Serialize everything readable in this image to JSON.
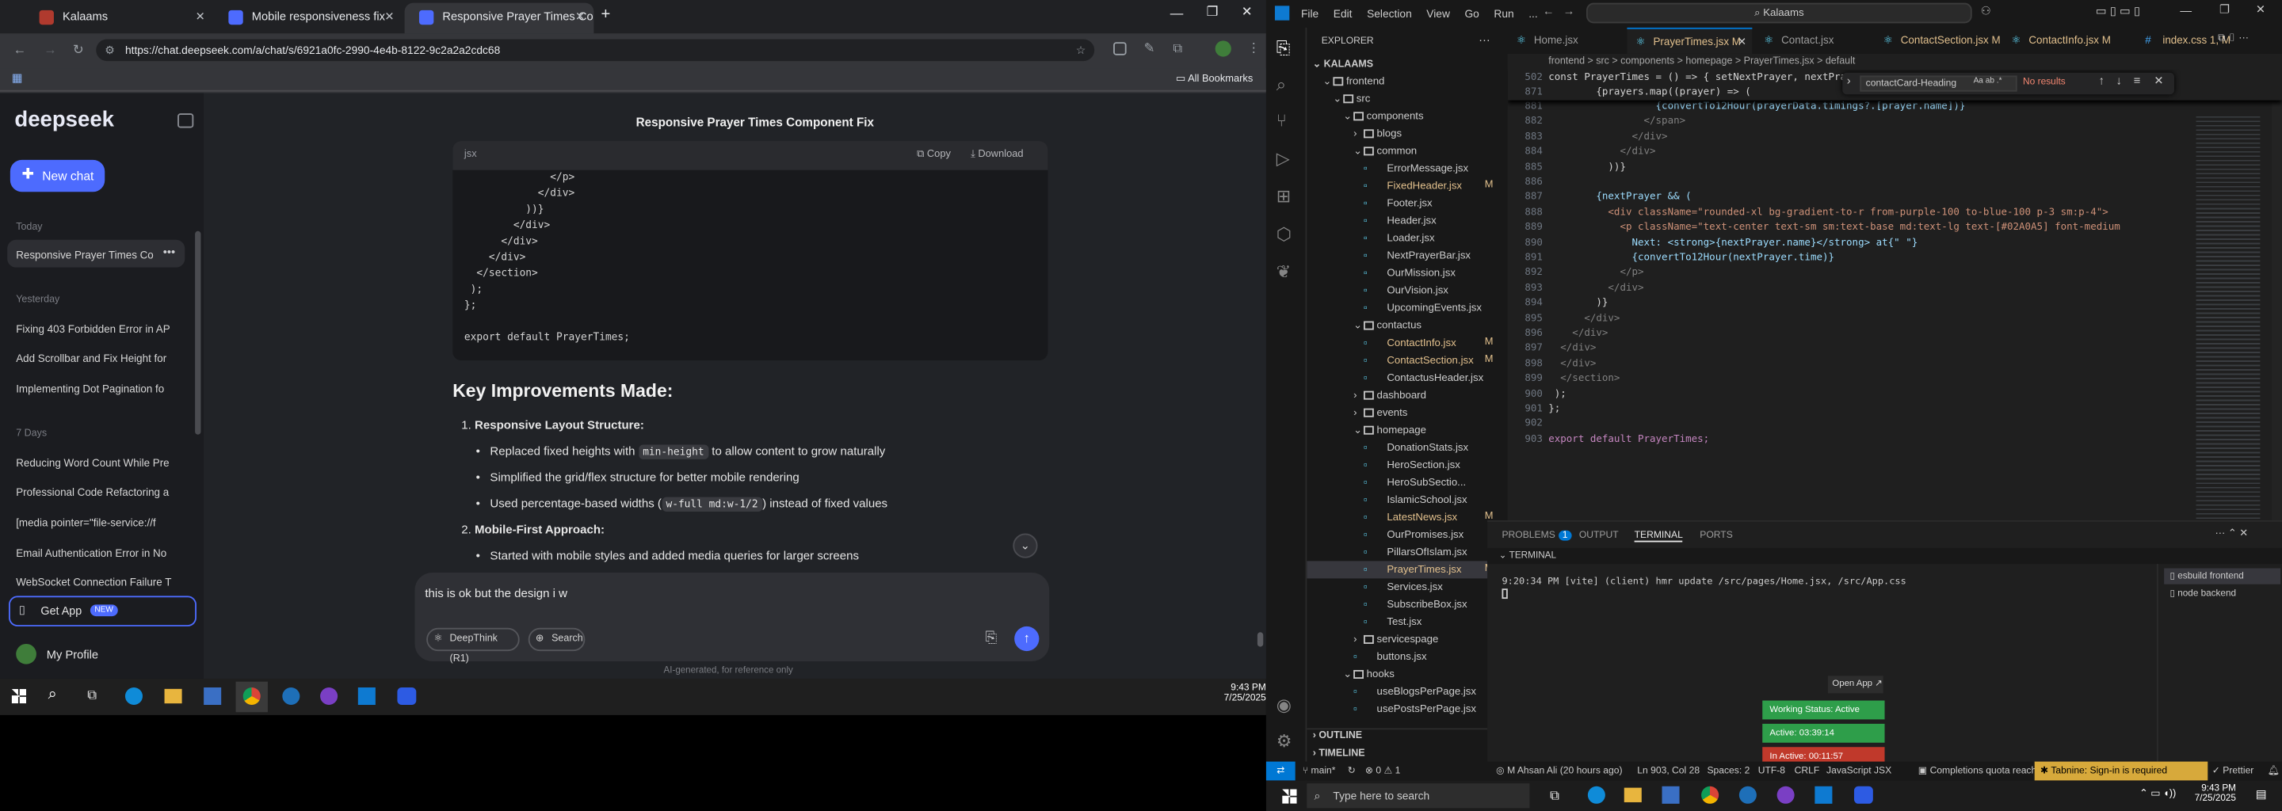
{
  "chrome": {
    "tabs": [
      {
        "label": "Kalaams",
        "active": false
      },
      {
        "label": "Mobile responsiveness fix",
        "active": false
      },
      {
        "label": "Responsive Prayer Times Comp",
        "active": true
      }
    ],
    "url": "https://chat.deepseek.com/a/chat/s/6921a0fc-2990-4e4b-8122-9c2a2a2cdc68",
    "bookmarks_label": "All Bookmarks"
  },
  "deepseek": {
    "logo": "deepseek",
    "new_chat": "New chat",
    "today_label": "Today",
    "today_items": [
      "Responsive Prayer Times Co"
    ],
    "yesterday_label": "Yesterday",
    "yesterday_items": [
      "Fixing 403 Forbidden Error in AP",
      "Add Scrollbar and Fix Height for",
      "Implementing Dot Pagination fo"
    ],
    "week_label": "7 Days",
    "week_items": [
      "Reducing Word Count While Pre",
      "Professional Code Refactoring a",
      "[media pointer=\"file-service://f",
      "Email Authentication Error in No",
      "WebSocket Connection Failure T"
    ],
    "get_app": "Get App",
    "new_badge": "NEW",
    "profile": "My Profile",
    "chat_title": "Responsive Prayer Times Component Fix",
    "code_lang": "jsx",
    "copy": "Copy",
    "download": "Download",
    "code_lines": [
      "              </p>",
      "            </div>",
      "          ))}",
      "        </div>",
      "      </div>",
      "    </div>",
      "  </section>",
      " );",
      "};",
      "",
      "export default PrayerTimes;"
    ],
    "heading": "Key Improvements Made:",
    "list1": {
      "num": "1.",
      "title": "Responsive Layout Structure:"
    },
    "b1_pre": "Replaced fixed heights with ",
    "b1_code": "min-height",
    "b1_post": " to allow content to grow naturally",
    "b2": "Simplified the grid/flex structure for better mobile rendering",
    "b3_pre": "Used percentage-based widths (",
    "b3_code": "w-full md:w-1/2",
    "b3_post": ") instead of fixed values",
    "list2": {
      "num": "2.",
      "title": "Mobile-First Approach:"
    },
    "b4": "Started with mobile styles and added media queries for larger screens",
    "input_text": "this is ok but the design i w",
    "deepthink": "DeepThink (R1)",
    "search": "Search",
    "footer": "AI-generated, for reference only"
  },
  "taskbar_left": {
    "time": "9:43 PM",
    "date": "7/25/2025"
  },
  "vscode": {
    "menu": [
      "File",
      "Edit",
      "Selection",
      "View",
      "Go",
      "Run",
      "..."
    ],
    "search_title": "Kalaams",
    "explorer_title": "EXPLORER",
    "root": "KALAAMS",
    "tree": [
      {
        "label": "frontend",
        "depth": 1,
        "folder": true,
        "open": true
      },
      {
        "label": "src",
        "depth": 2,
        "folder": true,
        "open": true
      },
      {
        "label": "components",
        "depth": 3,
        "folder": true,
        "open": true
      },
      {
        "label": "blogs",
        "depth": 4,
        "folder": true,
        "open": false
      },
      {
        "label": "common",
        "depth": 4,
        "folder": true,
        "open": true
      },
      {
        "label": "ErrorMessage.jsx",
        "depth": 5
      },
      {
        "label": "FixedHeader.jsx",
        "depth": 5,
        "mod": "M"
      },
      {
        "label": "Footer.jsx",
        "depth": 5
      },
      {
        "label": "Header.jsx",
        "depth": 5
      },
      {
        "label": "Loader.jsx",
        "depth": 5
      },
      {
        "label": "NextPrayerBar.jsx",
        "depth": 5
      },
      {
        "label": "OurMission.jsx",
        "depth": 5
      },
      {
        "label": "OurVision.jsx",
        "depth": 5
      },
      {
        "label": "UpcomingEvents.jsx",
        "depth": 5
      },
      {
        "label": "contactus",
        "depth": 4,
        "folder": true,
        "open": true
      },
      {
        "label": "ContactInfo.jsx",
        "depth": 5,
        "mod": "M"
      },
      {
        "label": "ContactSection.jsx",
        "depth": 5,
        "mod": "M"
      },
      {
        "label": "ContactusHeader.jsx",
        "depth": 5
      },
      {
        "label": "dashboard",
        "depth": 4,
        "folder": true,
        "open": false
      },
      {
        "label": "events",
        "depth": 4,
        "folder": true,
        "open": false
      },
      {
        "label": "homepage",
        "depth": 4,
        "folder": true,
        "open": true
      },
      {
        "label": "DonationStats.jsx",
        "depth": 5
      },
      {
        "label": "HeroSection.jsx",
        "depth": 5
      },
      {
        "label": "HeroSubSectio...",
        "depth": 5
      },
      {
        "label": "IslamicSchool.jsx",
        "depth": 5
      },
      {
        "label": "LatestNews.jsx",
        "depth": 5,
        "mod": "M"
      },
      {
        "label": "OurPromises.jsx",
        "depth": 5
      },
      {
        "label": "PillarsOfIslam.jsx",
        "depth": 5
      },
      {
        "label": "PrayerTimes.jsx",
        "depth": 5,
        "mod": "M",
        "selected": true
      },
      {
        "label": "Services.jsx",
        "depth": 5
      },
      {
        "label": "SubscribeBox.jsx",
        "depth": 5
      },
      {
        "label": "Test.jsx",
        "depth": 5
      },
      {
        "label": "servicespage",
        "depth": 4,
        "folder": true,
        "open": false
      },
      {
        "label": "buttons.jsx",
        "depth": 4
      },
      {
        "label": "hooks",
        "depth": 3,
        "folder": true,
        "open": true
      },
      {
        "label": "useBlogsPerPage.jsx",
        "depth": 4
      },
      {
        "label": "usePostsPerPage.jsx",
        "depth": 4
      }
    ],
    "outline": "OUTLINE",
    "timeline": "TIMELINE",
    "tabs": [
      {
        "label": "Home.jsx",
        "active": false
      },
      {
        "label": "PrayerTimes.jsx M",
        "active": true
      },
      {
        "label": "Contact.jsx",
        "active": false
      },
      {
        "label": "ContactSection.jsx M",
        "active": false
      },
      {
        "label": "ContactInfo.jsx M",
        "active": false
      },
      {
        "label": "index.css 1, M",
        "active": false
      }
    ],
    "breadcrumb": "frontend > src > components > homepage > PrayerTimes.jsx > default",
    "find_value": "contactCard-Heading",
    "find_results": "No results",
    "sticky": [
      {
        "n": "502",
        "t": "const PrayerTimes = () => { setNextPrayer, nextPrayer"
      },
      {
        "n": "871",
        "t": "        {prayers.map((prayer) => ("
      }
    ],
    "lines": [
      {
        "n": "881",
        "t": "                  {convertTo12Hour(prayerData.timings?.[prayer.name])}"
      },
      {
        "n": "882",
        "t": "                </span>"
      },
      {
        "n": "883",
        "t": "              </div>"
      },
      {
        "n": "884",
        "t": "            </div>"
      },
      {
        "n": "885",
        "t": "          ))}"
      },
      {
        "n": "886",
        "t": ""
      },
      {
        "n": "887",
        "t": "        {nextPrayer && ("
      },
      {
        "n": "888",
        "t": "          <div className=\"rounded-xl bg-gradient-to-r from-purple-100 to-blue-100 p-3 sm:p-4\">"
      },
      {
        "n": "889",
        "t": "            <p className=\"text-center text-sm sm:text-base md:text-lg text-[#02A0A5] font-medium"
      },
      {
        "n": "890",
        "t": "              Next: <strong>{nextPrayer.name}</strong> at{\" \"}"
      },
      {
        "n": "891",
        "t": "              {convertTo12Hour(nextPrayer.time)}"
      },
      {
        "n": "892",
        "t": "            </p>"
      },
      {
        "n": "893",
        "t": "          </div>"
      },
      {
        "n": "894",
        "t": "        )}"
      },
      {
        "n": "895",
        "t": "      </div>"
      },
      {
        "n": "896",
        "t": "    </div>"
      },
      {
        "n": "897",
        "t": "  </div>"
      },
      {
        "n": "898",
        "t": "  </div>"
      },
      {
        "n": "899",
        "t": "  </section>"
      },
      {
        "n": "900",
        "t": " );"
      },
      {
        "n": "901",
        "t": "};"
      },
      {
        "n": "902",
        "t": ""
      },
      {
        "n": "903",
        "t": "export default PrayerTimes;"
      }
    ],
    "panel_tabs": [
      "PROBLEMS",
      "OUTPUT",
      "TERMINAL",
      "PORTS"
    ],
    "problems_count": "1",
    "terminal_label": "TERMINAL",
    "terminal_line": "9:20:34 PM [vite] (client) hmr update /src/pages/Home.jsx, /src/App.css",
    "terminals": [
      "esbuild frontend",
      "node backend"
    ],
    "popup": {
      "open_app": "Open App",
      "working": "Working Status: Active",
      "active": "Active: 03:39:14",
      "inactive": "In Active: 00:11:57"
    },
    "status": {
      "branch": "main*",
      "errors": "0",
      "warnings": "1",
      "author": "M Ahsan Ali (20 hours ago)",
      "pos": "Ln 903, Col 28",
      "spaces": "Spaces: 2",
      "enc": "UTF-8",
      "eol": "CRLF",
      "lang": "JavaScript JSX",
      "quota": "Completions quota reached",
      "tabnine": "Tabnine: Sign-in is required",
      "prettier": "Prettier"
    }
  },
  "taskbar_right": {
    "search": "Type here to search",
    "time": "9:43 PM",
    "date": "7/25/2025"
  }
}
